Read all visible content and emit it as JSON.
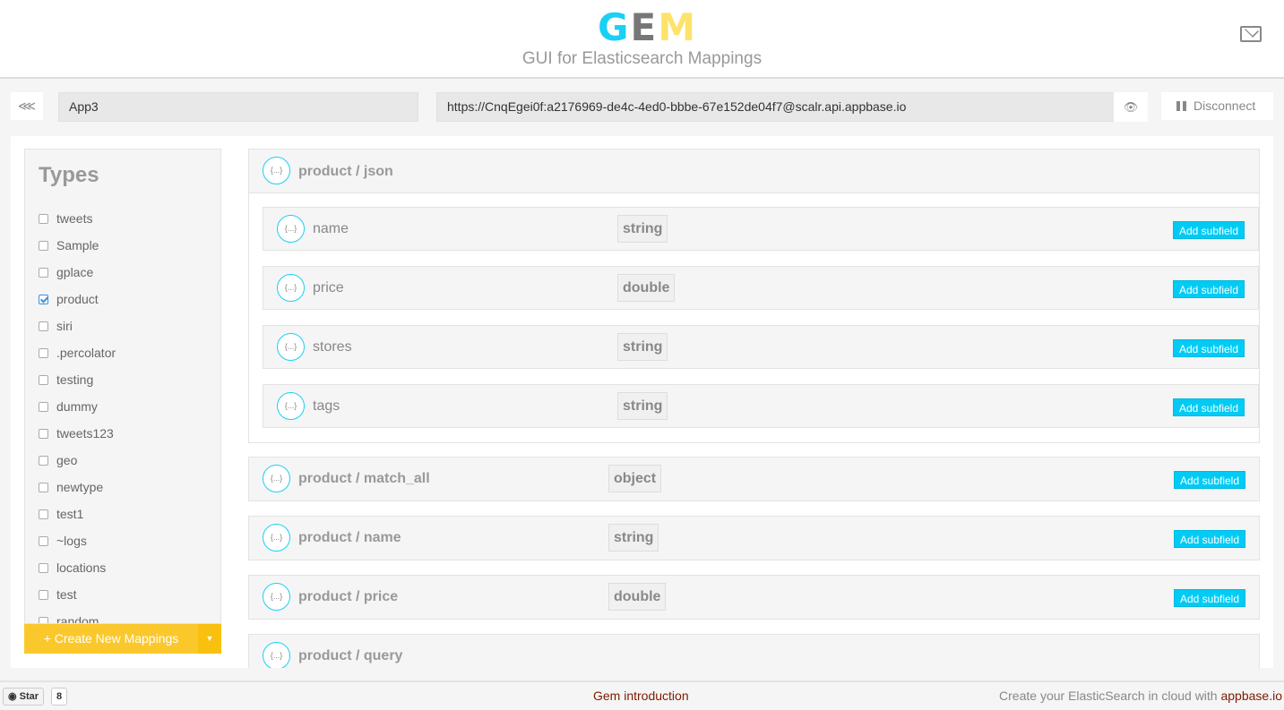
{
  "header": {
    "logo": {
      "g": "G",
      "e": "E",
      "m": "M"
    },
    "subtitle": "GUI for Elasticsearch Mappings"
  },
  "toolbar": {
    "app_name": "App3",
    "url": "https://CnqEgei0f:a2176969-de4c-4ed0-bbbe-67e152de04f7@scalr.api.appbase.io",
    "disconnect_label": "Disconnect"
  },
  "sidebar": {
    "title": "Types",
    "types": [
      {
        "label": "tweets",
        "checked": false
      },
      {
        "label": "Sample",
        "checked": false
      },
      {
        "label": "gplace",
        "checked": false
      },
      {
        "label": "product",
        "checked": true
      },
      {
        "label": "siri",
        "checked": false
      },
      {
        "label": ".percolator",
        "checked": false
      },
      {
        "label": "testing",
        "checked": false
      },
      {
        "label": "dummy",
        "checked": false
      },
      {
        "label": "tweets123",
        "checked": false
      },
      {
        "label": "geo",
        "checked": false
      },
      {
        "label": "newtype",
        "checked": false
      },
      {
        "label": "test1",
        "checked": false
      },
      {
        "label": "~logs",
        "checked": false
      },
      {
        "label": "locations",
        "checked": false
      },
      {
        "label": "test",
        "checked": false
      },
      {
        "label": "random",
        "checked": false
      }
    ],
    "create_label": "+ Create New Mappings"
  },
  "icon_text": "{...}",
  "add_subfield_label": "Add subfield",
  "mappings": {
    "json": {
      "title": "product / json",
      "fields": [
        {
          "name": "name",
          "type": "string"
        },
        {
          "name": "price",
          "type": "double"
        },
        {
          "name": "stores",
          "type": "string"
        },
        {
          "name": "tags",
          "type": "string"
        }
      ]
    },
    "others": [
      {
        "title": "product / match_all",
        "type": "object"
      },
      {
        "title": "product / name",
        "type": "string"
      },
      {
        "title": "product / price",
        "type": "double"
      },
      {
        "title": "product / query",
        "type": ""
      }
    ]
  },
  "footer": {
    "star_label": "Star",
    "star_count": "8",
    "intro_link": "Gem introduction",
    "cloud_text": "Create your ElasticSearch in cloud with ",
    "cloud_link": "appbase.io"
  },
  "colors": {
    "accent": "#00cbf5",
    "create_button": "#fbc82c",
    "link": "#7a1a00"
  }
}
